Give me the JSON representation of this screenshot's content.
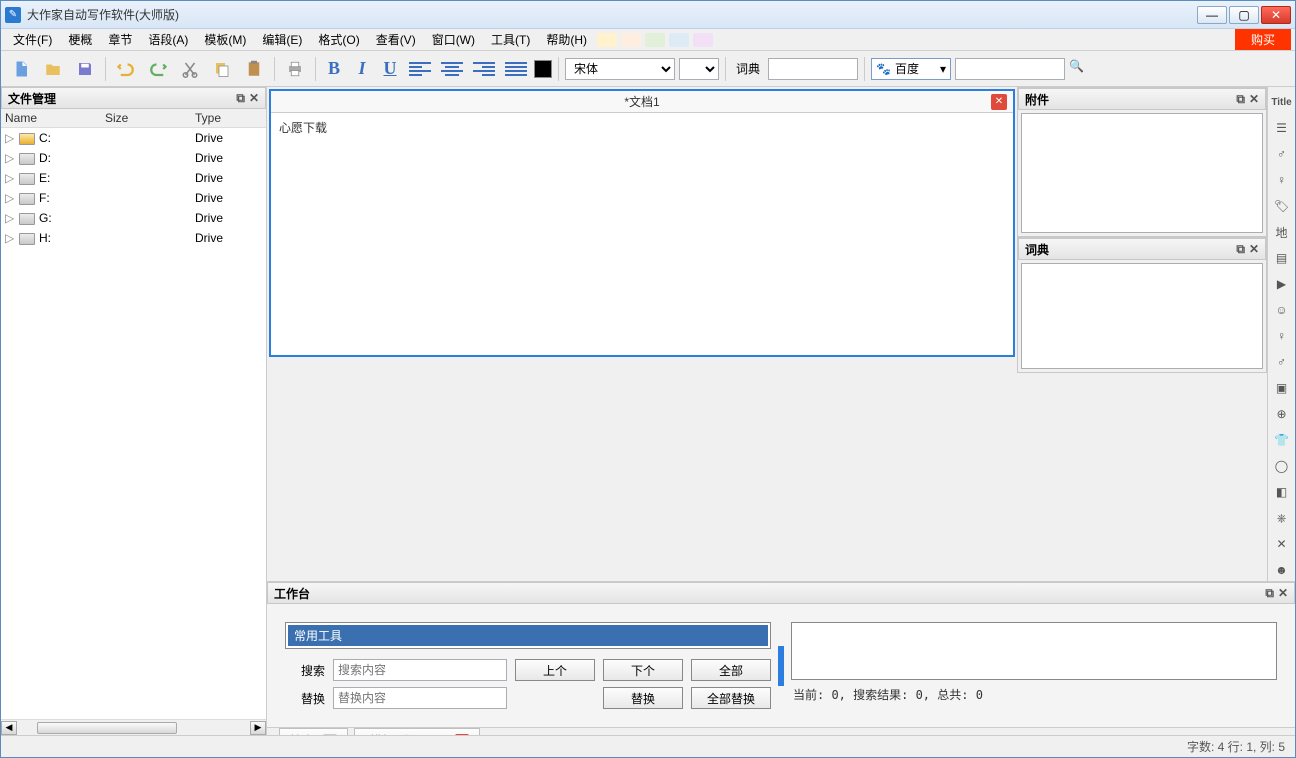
{
  "titlebar": {
    "title": "大作家自动写作软件(大师版)"
  },
  "menu": {
    "items": [
      "文件(F)",
      "梗概",
      "章节",
      "语段(A)",
      "模板(M)",
      "编辑(E)",
      "格式(O)",
      "查看(V)",
      "窗口(W)",
      "工具(T)",
      "帮助(H)"
    ],
    "swatches": [
      "#fff2cc",
      "#fdeee0",
      "#e2f0d9",
      "#deebf7",
      "#f2e0f7"
    ],
    "buy": "购买"
  },
  "toolbar": {
    "font": "宋体",
    "dict_label": "词典",
    "dict_value": "",
    "search_engine": "百度",
    "search_value": ""
  },
  "file_panel": {
    "title": "文件管理",
    "cols": [
      "Name",
      "Size",
      "Type"
    ],
    "drives": [
      {
        "name": "C:",
        "type": "Drive",
        "first": true
      },
      {
        "name": "D:",
        "type": "Drive"
      },
      {
        "name": "E:",
        "type": "Drive"
      },
      {
        "name": "F:",
        "type": "Drive"
      },
      {
        "name": "G:",
        "type": "Drive"
      },
      {
        "name": "H:",
        "type": "Drive"
      }
    ]
  },
  "doc": {
    "title": "*文档1",
    "content": "心愿下载"
  },
  "attach": {
    "title": "附件"
  },
  "dict_panel": {
    "title": "词典"
  },
  "worktable": {
    "title": "工作台",
    "selected": "常用工具",
    "search_label": "搜索",
    "search_placeholder": "搜索内容",
    "replace_label": "替换",
    "replace_placeholder": "替换内容",
    "btn_prev": "上个",
    "btn_next": "下个",
    "btn_all": "全部",
    "btn_replace": "替换",
    "btn_replace_all": "全部替换",
    "status": "当前: 0, 搜索结果: 0, 总共: 0"
  },
  "bottom_tabs": {
    "search": "搜索:",
    "template": "*模板: 常用工具"
  },
  "statusbar": {
    "text": "字数: 4 行: 1, 列: 5"
  },
  "iconbar_title": "Title"
}
